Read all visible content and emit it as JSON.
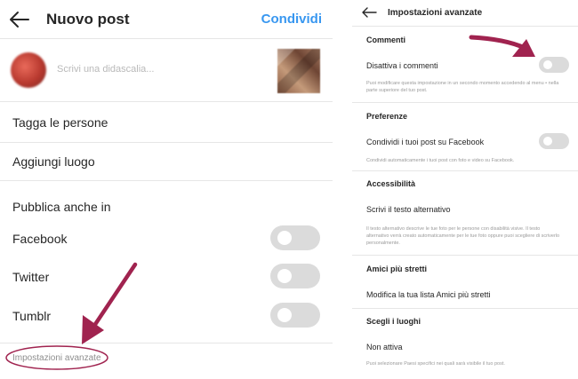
{
  "left": {
    "header": {
      "title": "Nuovo post",
      "share_label": "Condividi"
    },
    "composer": {
      "caption_placeholder": "Scrivi una didascalia..."
    },
    "rows": {
      "tag_people": "Tagga le persone",
      "add_location": "Aggiungi luogo"
    },
    "publish_also": {
      "heading": "Pubblica anche in",
      "items": [
        {
          "label": "Facebook",
          "enabled": false
        },
        {
          "label": "Twitter",
          "enabled": false
        },
        {
          "label": "Tumblr",
          "enabled": false
        }
      ]
    },
    "advanced_link": "Impostazioni avanzate"
  },
  "right": {
    "header": {
      "title": "Impostazioni avanzate"
    },
    "comments": {
      "heading": "Commenti",
      "toggle_label": "Disattiva i commenti",
      "enabled": false,
      "note": "Puoi modificare questa impostazione in un secondo momento accedendo al menu • nella parte superiore del tuo post."
    },
    "preferences": {
      "heading": "Preferenze",
      "toggle_label": "Condividi i tuoi post su Facebook",
      "enabled": false,
      "note": "Condividi automaticamente i tuoi post con foto e video su Facebook."
    },
    "accessibility": {
      "heading": "Accessibilità",
      "item": "Scrivi il testo alternativo",
      "note": "Il testo alternativo descrive le tue foto per le persone con disabilità visive. Il testo alternativo verrà creato automaticamente per le tue foto oppure puoi scegliere di scriverlo personalmente."
    },
    "close_friends": {
      "heading": "Amici più stretti",
      "item": "Modifica la tua lista Amici più stretti"
    },
    "places": {
      "heading": "Scegli i luoghi",
      "item": "Non attiva",
      "note": "Puoi selezionare Paesi specifici nei quali sarà visibile il tuo post."
    }
  },
  "colors": {
    "accent_blue": "#3897f0",
    "annotation_arrow": "#a0234f",
    "toggle_off": "#dbdbdb"
  }
}
